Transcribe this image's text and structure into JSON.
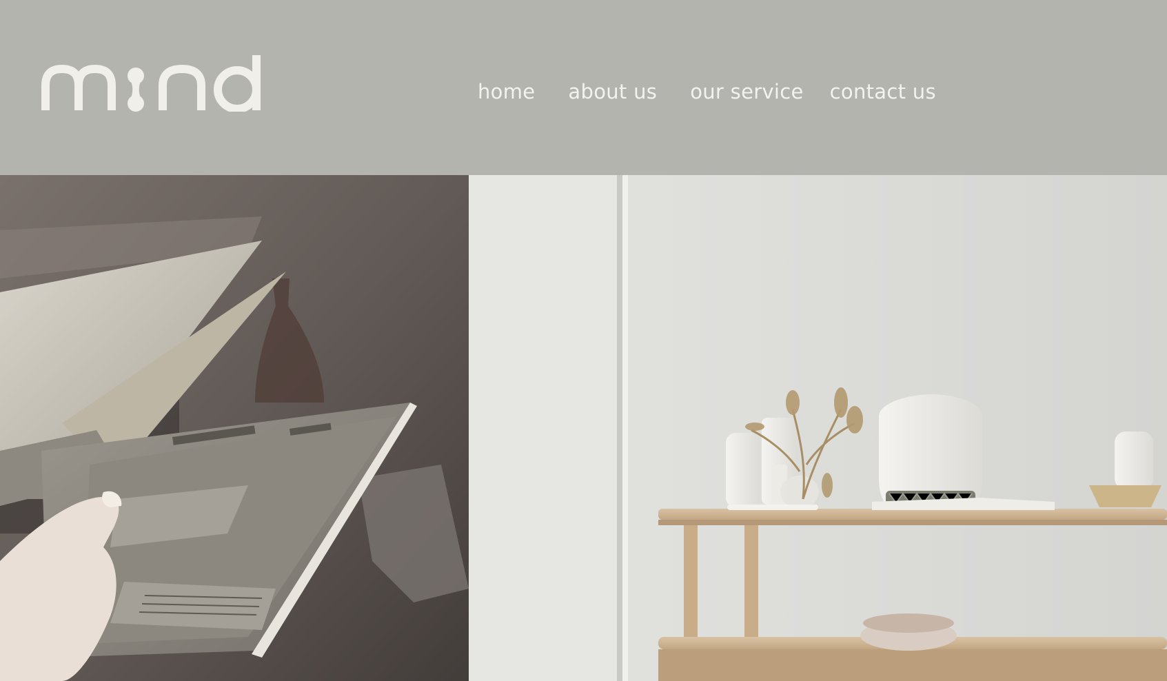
{
  "brand": {
    "logo_text": "mind",
    "logo_icon": "mind-wordmark-logo"
  },
  "nav": {
    "items": [
      {
        "label": "home"
      },
      {
        "label": "about us"
      },
      {
        "label": "our service"
      },
      {
        "label": "contact us"
      }
    ]
  },
  "colors": {
    "header_bg": "#b3b4ae",
    "nav_text": "#f2f2ee",
    "logo": "#f0efe9"
  },
  "images": {
    "left": "hand-holding-open-magazine-photo",
    "right": "wooden-shelf-with-white-vases-photo"
  }
}
